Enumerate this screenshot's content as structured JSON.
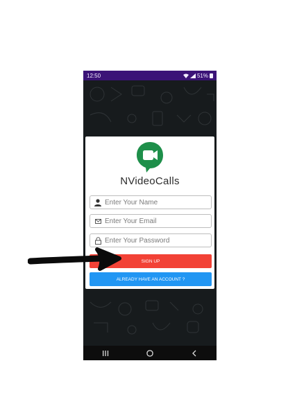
{
  "status_bar": {
    "time": "12:50",
    "battery_text": "51%"
  },
  "app": {
    "title": "NVideoCalls"
  },
  "form": {
    "name_placeholder": "Enter Your Name",
    "email_placeholder": "Enter Your Email",
    "password_placeholder": "Enter Your Password"
  },
  "buttons": {
    "signup_label": "SIGN UP",
    "login_label": "ALREADY HAVE AN ACCOUNT ?"
  },
  "colors": {
    "status_bar": "#3b1377",
    "signup": "#f24236",
    "login": "#2196f3",
    "logo": "#1e8f4a"
  },
  "icons": [
    "wifi-icon",
    "signal-icon",
    "battery-icon",
    "person-icon",
    "email-icon",
    "lock-icon",
    "video-camera-icon",
    "recents-icon",
    "home-icon",
    "back-icon",
    "annotation-arrow-icon"
  ]
}
